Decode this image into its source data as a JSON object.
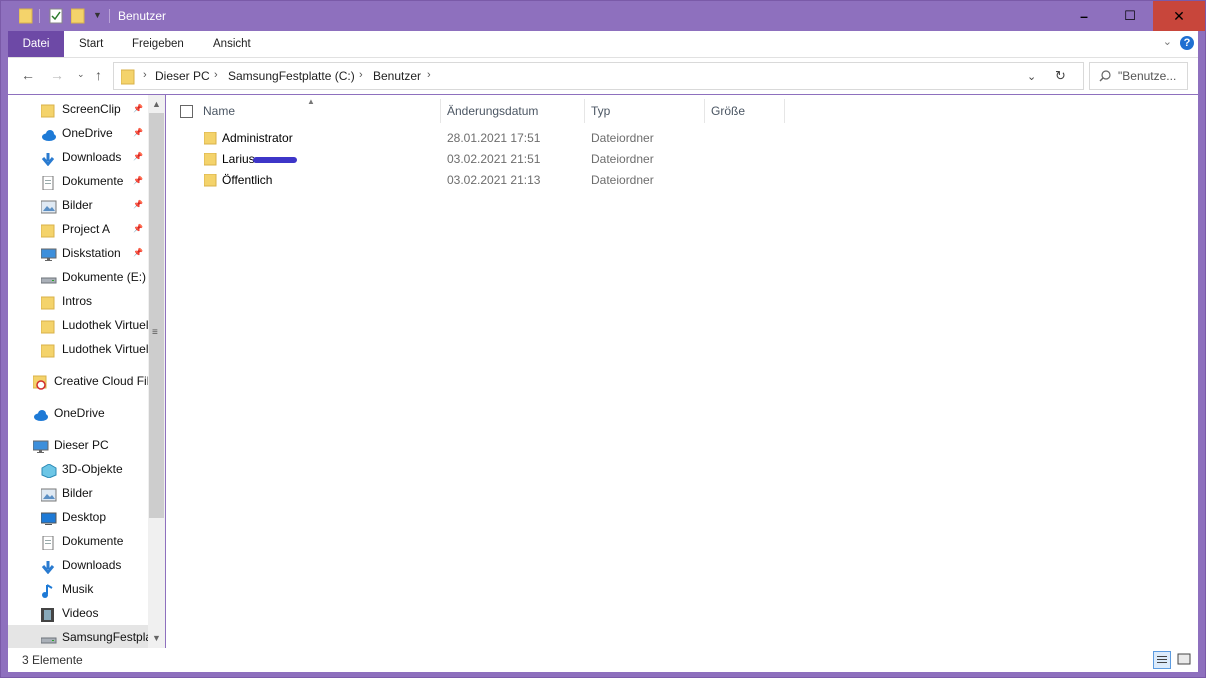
{
  "window": {
    "title": "Benutzer",
    "accent": "#8e70be",
    "controls": {
      "minimize": "–",
      "maximize": "☐",
      "close": "✕"
    }
  },
  "ribbon": {
    "tabs": [
      "Datei",
      "Start",
      "Freigeben",
      "Ansicht"
    ],
    "help": "?"
  },
  "address": {
    "crumbs": [
      "Dieser PC",
      "SamsungFestplatte (C:)",
      "Benutzer"
    ],
    "search_placeholder": "\"Benutze..."
  },
  "nav": {
    "quick_access": [
      {
        "label": "ScreenClip",
        "icon": "folder-icon",
        "pinned": true
      },
      {
        "label": "OneDrive",
        "icon": "cloud-icon",
        "pinned": true
      },
      {
        "label": "Downloads",
        "icon": "download-icon",
        "pinned": true
      },
      {
        "label": "Dokumente",
        "icon": "document-icon",
        "pinned": true
      },
      {
        "label": "Bilder",
        "icon": "pictures-icon",
        "pinned": true
      },
      {
        "label": "Project A",
        "icon": "folder-icon",
        "pinned": true
      },
      {
        "label": "Diskstation",
        "icon": "monitor-icon",
        "pinned": true
      },
      {
        "label": "Dokumente (E:)",
        "icon": "drive-icon",
        "pinned": false
      },
      {
        "label": "Intros",
        "icon": "folder-icon",
        "pinned": false
      },
      {
        "label": "Ludothek Virtuel",
        "icon": "folder-icon",
        "pinned": false
      },
      {
        "label": "Ludothek Virtuel",
        "icon": "folder-icon",
        "pinned": false
      }
    ],
    "creative_cloud": "Creative Cloud Fil",
    "onedrive": "OneDrive",
    "this_pc": "Dieser PC",
    "pc_items": [
      {
        "label": "3D-Objekte",
        "icon": "cube-icon"
      },
      {
        "label": "Bilder",
        "icon": "pictures-icon"
      },
      {
        "label": "Desktop",
        "icon": "desktop-icon"
      },
      {
        "label": "Dokumente",
        "icon": "document-icon"
      },
      {
        "label": "Downloads",
        "icon": "download-icon"
      },
      {
        "label": "Musik",
        "icon": "music-icon"
      },
      {
        "label": "Videos",
        "icon": "video-icon"
      },
      {
        "label": "SamsungFestpla",
        "icon": "drive-icon"
      }
    ]
  },
  "columns": [
    "Name",
    "Änderungsdatum",
    "Typ",
    "Größe"
  ],
  "files": [
    {
      "name": "Administrator",
      "date": "28.01.2021 17:51",
      "type": "Dateiordner",
      "redacted": false
    },
    {
      "name": "Larius",
      "date": "03.02.2021 21:51",
      "type": "Dateiordner",
      "redacted": true
    },
    {
      "name": "Öffentlich",
      "date": "03.02.2021 21:13",
      "type": "Dateiordner",
      "redacted": false
    }
  ],
  "status": {
    "count": "3 Elemente"
  }
}
